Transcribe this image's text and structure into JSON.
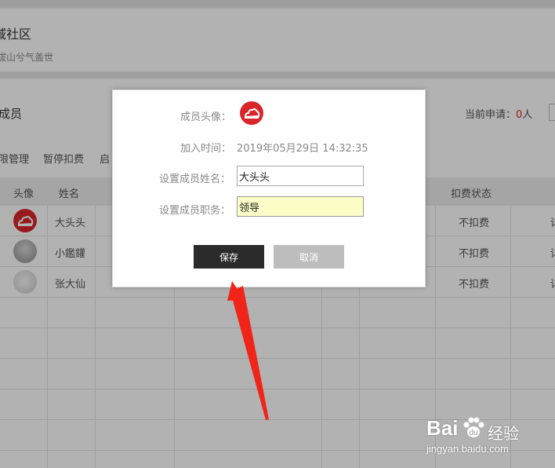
{
  "community": {
    "name": "域社区",
    "motto": "拔山兮气盖世"
  },
  "members": {
    "title": "成员",
    "apply_label": "当前申请：",
    "apply_count": "0",
    "apply_unit": "人",
    "toolbar": [
      "限管理",
      "暂停扣费",
      "启"
    ],
    "columns": {
      "avatar": "头像",
      "name": "姓名",
      "billing": "扣费状态"
    },
    "rows": [
      {
        "name": "大头头",
        "billing": "不扣费",
        "tail": "详"
      },
      {
        "name": "小鑑鑵",
        "billing": "不扣费",
        "tail": "详"
      },
      {
        "name": "张大仙",
        "billing": "不扣费",
        "tail": "详"
      }
    ]
  },
  "modal": {
    "avatar_label": "成员头像：",
    "join_label": "加入时间：",
    "join_time": "2019年05月29日 14:32:35",
    "name_label": "设置成员姓名：",
    "name_value": "大头头",
    "role_label": "设置成员职务：",
    "role_value": "领导",
    "save_label": "保存",
    "cancel_label": "取消"
  },
  "watermark": {
    "brand": "Bai",
    "brand_suffix": "经验",
    "url": "jingyan.baidu.com"
  },
  "colors": {
    "accent_red": "#d9262b",
    "save_bg": "#2b2b2b",
    "cancel_bg": "#bdbdbd",
    "role_input_bg": "#fdfdc8",
    "arrow": "#f02418"
  }
}
